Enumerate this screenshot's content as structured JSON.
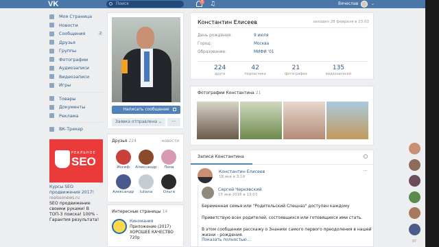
{
  "topbar": {
    "logo": "VK",
    "search_placeholder": "Поиск",
    "notifications_badge": "7",
    "user_name": "Вячеслав",
    "music_icon": "♫"
  },
  "sidebar": {
    "items": [
      {
        "label": "Моя Страница",
        "icon": "home-icon"
      },
      {
        "label": "Новости",
        "icon": "news-icon"
      },
      {
        "label": "Сообщения",
        "icon": "messages-icon",
        "count": "2"
      },
      {
        "label": "Друзья",
        "icon": "friends-icon"
      },
      {
        "label": "Группы",
        "icon": "groups-icon"
      },
      {
        "label": "Фотографии",
        "icon": "photos-icon"
      },
      {
        "label": "Аудиозаписи",
        "icon": "audio-icon"
      },
      {
        "label": "Видеозаписи",
        "icon": "video-icon"
      },
      {
        "label": "Игры",
        "icon": "games-icon"
      }
    ],
    "items2": [
      {
        "label": "Товары",
        "icon": "goods-icon"
      },
      {
        "label": "Документы",
        "icon": "documents-icon"
      },
      {
        "label": "Реклама",
        "icon": "ads-icon"
      }
    ],
    "items3": [
      {
        "label": "ВК-Трекер",
        "icon": "tracker-icon"
      }
    ],
    "ad": {
      "image_label_top": "РЕАЛЬНОЕ",
      "image_label_big": "SEO",
      "title": "Курсы SEO продвижения 2017!",
      "site": "realseonews.ru",
      "text": "SEO продвижение своими руками! В ТОП-3 поиска! 100% - Гарантия результата!"
    }
  },
  "profile_photo": {
    "message_button": "Написать сообщение",
    "request_button": "Заявка отправлена ⌄",
    "more_button": "···"
  },
  "friends": {
    "title": "Друзья",
    "count": "224",
    "all_link": "новости",
    "list": [
      {
        "name": "Иосиф",
        "color": "#c8403a"
      },
      {
        "name": "Александр",
        "color": "#8b4a2b"
      },
      {
        "name": "Лена",
        "color": "#d89ab2"
      },
      {
        "name": "Александр",
        "color": "#4a5a8c"
      },
      {
        "name": "Iuliana",
        "color": "#c6ccd3"
      },
      {
        "name": "Ольга",
        "color": "#2b2b2b"
      }
    ]
  },
  "interesting": {
    "title": "Интересные страницы",
    "count": "14",
    "item_title": "Киномания",
    "item_sub": "Приложение (2017)",
    "item_sub2": "ХОРОШЕЕ КАЧЕСТВО",
    "item_sub3": "720p"
  },
  "profile": {
    "name": "Константин Елисеев",
    "last_seen": "заходил 28 февраля в 23:03",
    "rows": [
      {
        "key": "День рождения:",
        "value": "9 июля"
      },
      {
        "key": "Город:",
        "value": "Москва"
      },
      {
        "key": "Образование:",
        "value": "МИФИ '01"
      }
    ],
    "counters": [
      {
        "num": "224",
        "label": "друга"
      },
      {
        "num": "42",
        "label": "подписчика"
      },
      {
        "num": "21",
        "label": "фотография"
      },
      {
        "num": "135",
        "label": "видеозаписей"
      }
    ]
  },
  "photos": {
    "title": "Фотографии Константина",
    "count": "21"
  },
  "wall": {
    "tab": "Записи Константина",
    "post": {
      "author": "Константин Елисеев",
      "date": "18 янв в 3:19",
      "repost_author": "Сергей Черкявский",
      "repost_date": "15 янв 2016 в 13:03",
      "lines": [
        "Беременная семья или \"Родительский Спецназ\" доступен каждому",
        "Приветствую всех родителей, состоявшихся или готовящихся ими стать.",
        "В этом сообщении расскажу о Знаниях самого первого преодоления в нашей",
        "жизни - рождения."
      ],
      "more": "Показать полностью..."
    }
  },
  "rail": {
    "count": "97"
  }
}
